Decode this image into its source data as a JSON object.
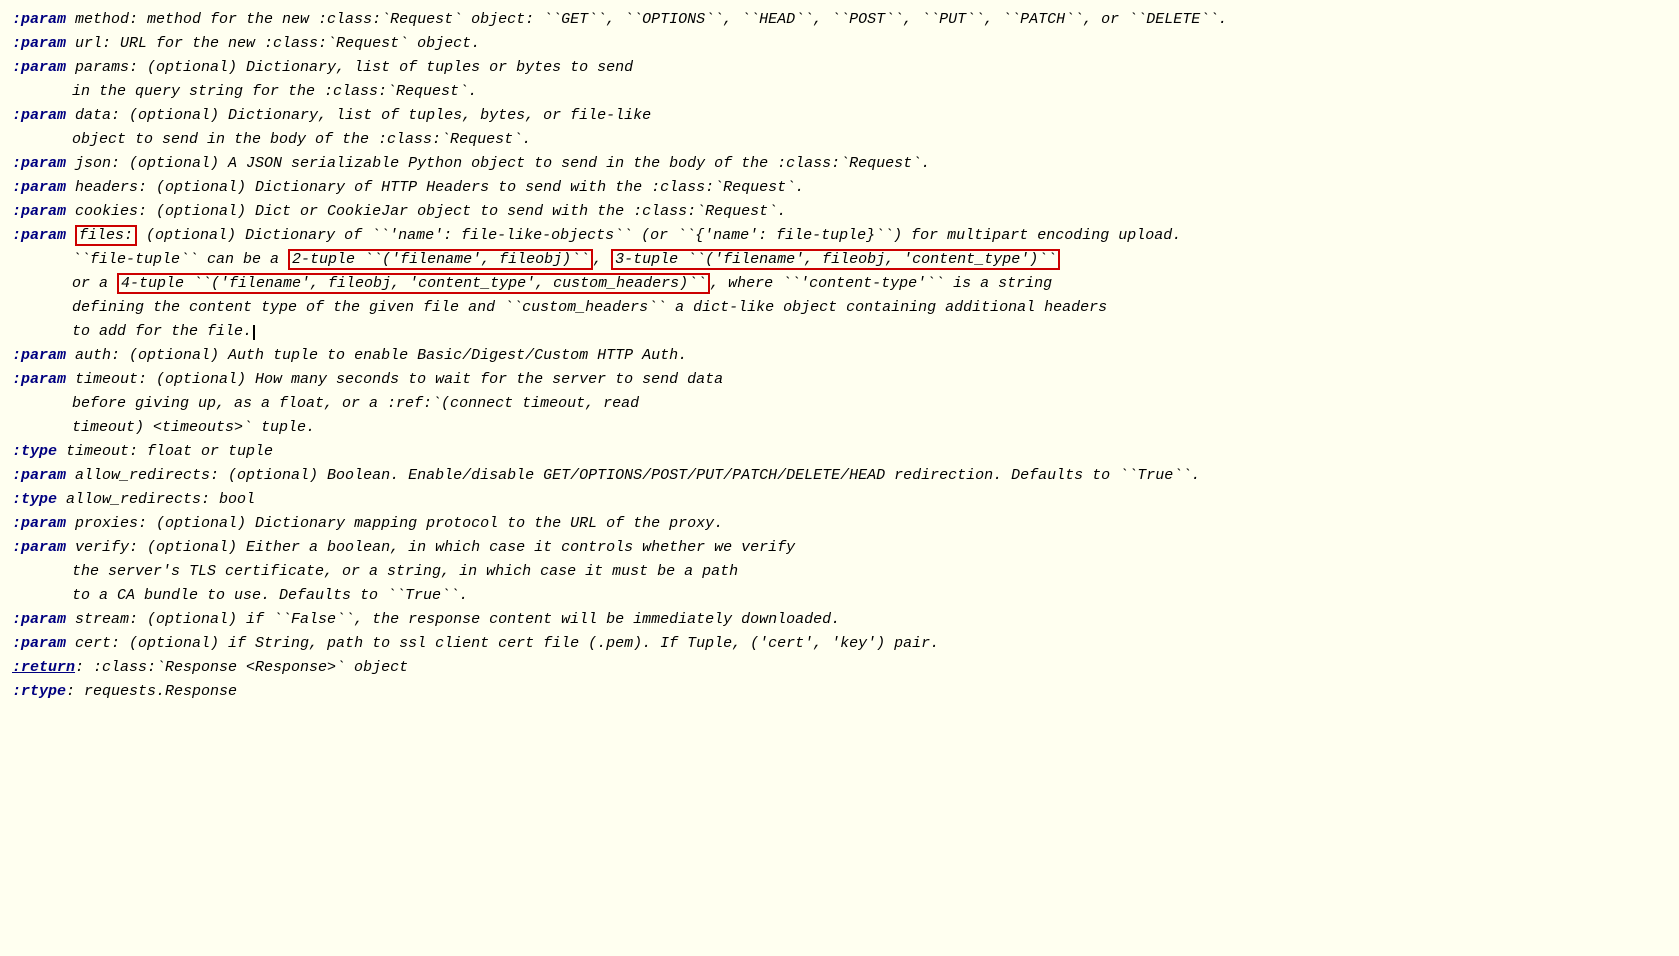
{
  "lines": [
    {
      "id": "line1",
      "tag": ":param",
      "text": " method: method for the new :class:`Request` object: ``GET``, ``OPTIONS``, ``HEAD``, ``POST``, ``PUT``, ``PATCH``, or ``DELETE``.",
      "indent": false,
      "highlights": []
    },
    {
      "id": "line2",
      "tag": ":param",
      "text": " url: URL for the new :class:`Request` object.",
      "indent": false,
      "highlights": []
    },
    {
      "id": "line3",
      "tag": ":param",
      "text": " params: (optional) Dictionary, list of tuples or bytes to send",
      "indent": false,
      "highlights": []
    },
    {
      "id": "line3b",
      "tag": "",
      "text": "in the query string for the :class:`Request`.",
      "indent": true,
      "highlights": []
    },
    {
      "id": "line4",
      "tag": ":param",
      "text": " data: (optional) Dictionary, list of tuples, bytes, or file-like",
      "indent": false,
      "highlights": []
    },
    {
      "id": "line4b",
      "tag": "",
      "text": "object to send in the body of the :class:`Request`.",
      "indent": true,
      "highlights": []
    },
    {
      "id": "line5",
      "tag": ":param",
      "text": " json: (optional) A JSON serializable Python object to send in the body of the :class:`Request`.",
      "indent": false,
      "highlights": []
    },
    {
      "id": "line6",
      "tag": ":param",
      "text": " headers: (optional) Dictionary of HTTP Headers to send with the :class:`Request`.",
      "indent": false,
      "highlights": []
    },
    {
      "id": "line7",
      "tag": ":param",
      "text": " cookies: (optional) Dict or CookieJar object to send with the :class:`Request`.",
      "indent": false,
      "highlights": []
    },
    {
      "id": "line8",
      "tag": ":param",
      "text_before_hl1": " ",
      "hl1": "files:",
      "text_after_hl1": " (optional) Dictionary of ``'name': file-like-objects`` (or ``{'name': file-tuple}``) for multipart encoding upload.",
      "indent": false,
      "type": "files_line"
    },
    {
      "id": "line8b",
      "indent": true,
      "type": "filetuple_line",
      "text_before_hl": "``file-tuple`` can be a ",
      "hl2": "2-tuple ``('filename', fileobj)``",
      "text_mid": ", ",
      "hl3": "3-tuple ``('filename', fileobj, 'content_type')``",
      "text_after": ""
    },
    {
      "id": "line8c",
      "indent": true,
      "type": "fourtuple_line",
      "text_before": "or a ",
      "hl4": "4-tuple ``('filename', fileobj, 'content_type', custom_headers)``",
      "text_after": ", where ``'content-type'`` is a string"
    },
    {
      "id": "line8d",
      "indent": true,
      "text": "defining the content type of the given file and ``custom_headers`` a dict-like object containing additional headers",
      "type": "normal_indent"
    },
    {
      "id": "line8e",
      "indent": true,
      "text": "to add for the file.",
      "type": "normal_indent_cursor"
    },
    {
      "id": "line9",
      "tag": ":param",
      "text": " auth: (optional) Auth tuple to enable Basic/Digest/Custom HTTP Auth.",
      "indent": false
    },
    {
      "id": "line10",
      "tag": ":param",
      "text": " timeout: (optional) How many seconds to wait for the server to send data",
      "indent": false
    },
    {
      "id": "line10b",
      "tag": "",
      "text": "before giving up, as a float, or a :ref:`(connect timeout, read",
      "indent": true
    },
    {
      "id": "line10c",
      "tag": "",
      "text": "timeout) <timeouts>` tuple.",
      "indent": true
    },
    {
      "id": "line11",
      "tag": ":type",
      "text": " timeout: float or tuple",
      "indent": false
    },
    {
      "id": "line12",
      "tag": ":param",
      "text": " allow_redirects: (optional) Boolean. Enable/disable GET/OPTIONS/POST/PUT/PATCH/DELETE/HEAD redirection. Defaults to ``True``.",
      "indent": false
    },
    {
      "id": "line13",
      "tag": ":type",
      "text": " allow_redirects: bool",
      "indent": false
    },
    {
      "id": "line14",
      "tag": ":param",
      "text": " proxies: (optional) Dictionary mapping protocol to the URL of the proxy.",
      "indent": false
    },
    {
      "id": "line15",
      "tag": ":param",
      "text": " verify: (optional) Either a boolean, in which case it controls whether we verify",
      "indent": false
    },
    {
      "id": "line15b",
      "tag": "",
      "text": "the server's TLS certificate, or a string, in which case it must be a path",
      "indent": true
    },
    {
      "id": "line15c",
      "tag": "",
      "text": "to a CA bundle to use. Defaults to ``True``.",
      "indent": true
    },
    {
      "id": "line16",
      "tag": ":param",
      "text": " stream: (optional) if ``False``, the response content will be immediately downloaded.",
      "indent": false
    },
    {
      "id": "line17",
      "tag": ":param",
      "text": " cert: (optional) if String, path to ssl client cert file (.pem). If Tuple, ('cert', 'key') pair.",
      "indent": false
    },
    {
      "id": "line18",
      "tag": ":return",
      "text": ": :class:`Response <Response>` object",
      "indent": false,
      "type": "return"
    },
    {
      "id": "line19",
      "tag": ":rtype",
      "text": ": requests.Response",
      "indent": false,
      "type": "rtype"
    }
  ]
}
